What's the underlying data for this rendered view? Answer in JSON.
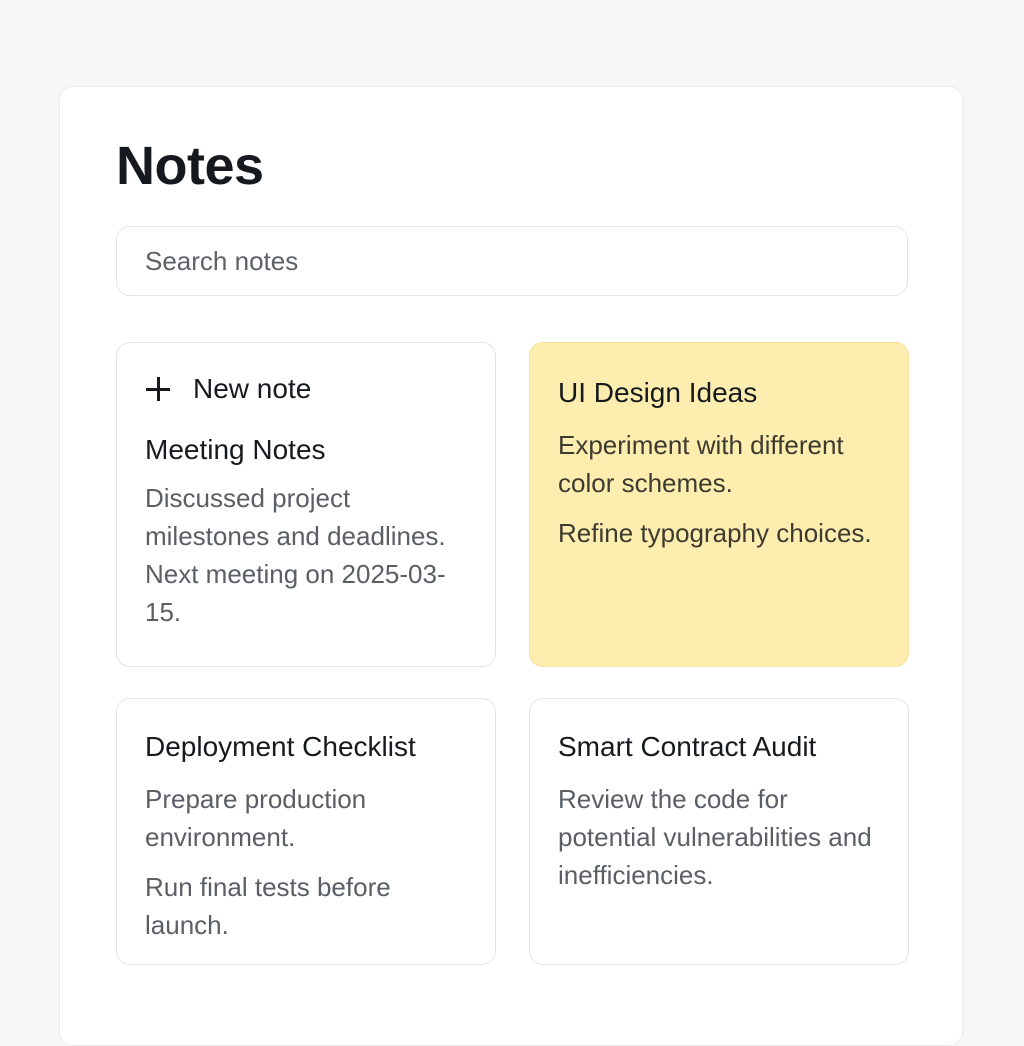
{
  "header": {
    "title": "Notes"
  },
  "search": {
    "placeholder": "Search notes"
  },
  "new_note": {
    "label": "New note",
    "icon": "plus-icon"
  },
  "notes": [
    {
      "title": "Meeting Notes",
      "paragraphs": [
        "Discussed project milestones and deadlines. Next meeting on 2025-03-15."
      ],
      "color": "#ffffff"
    },
    {
      "title": "UI Design Ideas",
      "paragraphs": [
        "Experiment with different color schemes.",
        "Refine typography choices."
      ],
      "color": "#fdeeb0"
    },
    {
      "title": "Deployment Checklist",
      "paragraphs": [
        "Prepare production environment.",
        "Run final tests before launch."
      ],
      "color": "#ffffff"
    },
    {
      "title": "Smart Contract Audit",
      "paragraphs": [
        "Review the code for potential vulnerabilities and inefficiencies."
      ],
      "color": "#ffffff"
    }
  ]
}
